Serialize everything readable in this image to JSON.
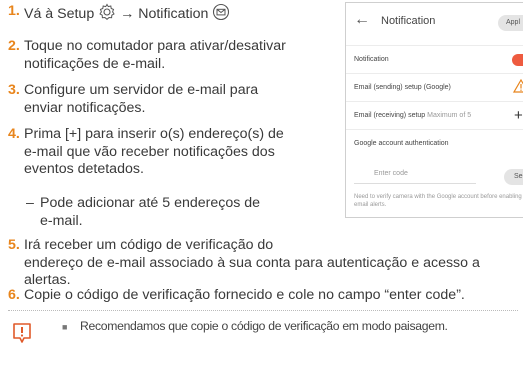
{
  "steps": [
    {
      "num": "1.",
      "pre": "Vá à Setup ",
      "arrow": " → Notification "
    },
    {
      "num": "2.",
      "line1": "Toque no comutador para ativar/desativar",
      "line2": "notificações de e-mail."
    },
    {
      "num": "3.",
      "line1": "Configure um servidor de e-mail para",
      "line2": "enviar notificações."
    },
    {
      "num": "4.",
      "line1": "Prima [+] para inserir o(s) endereço(s) de",
      "line2": "e-mail que vão receber notificações dos",
      "line3": "eventos detetados."
    },
    {
      "num": "5.",
      "line1": "Irá receber um código de verificação do",
      "line2": "endereço de e-mail associado à sua conta para autenticação e acesso a",
      "line3": "alertas."
    },
    {
      "num": "6.",
      "line1": "Copie o código de verificação fornecido e cole no campo “enter code”."
    }
  ],
  "sub_step": {
    "dash": "–",
    "line1": "Pode adicionar até 5 endereços de",
    "line2": "e-mail."
  },
  "phone": {
    "title": "Notification",
    "apply": "Appl",
    "rows": {
      "notification": "Notification",
      "sending": "Email (sending) setup (Google)",
      "receiving": "Email (receiving) setup",
      "receiving_hint": "Maximum of 5",
      "google_auth": "Google account authentication"
    },
    "code_placeholder": "Enter code",
    "send": "Send",
    "note": "Need to verify camera with the Google account before enabling email alerts."
  },
  "note": {
    "bullet": "■",
    "text": "Recomendamos que copie o código de verificação em modo paisagem."
  },
  "colors": {
    "accent": "#e8851c",
    "toggle": "#ee5b3f",
    "warning": "#e8851c",
    "note_icon": "#e05a2a"
  },
  "icons": [
    "gear-icon",
    "mail-icon",
    "back-arrow-icon",
    "toggle-switch",
    "warning-icon",
    "plus-icon",
    "caution-icon"
  ]
}
